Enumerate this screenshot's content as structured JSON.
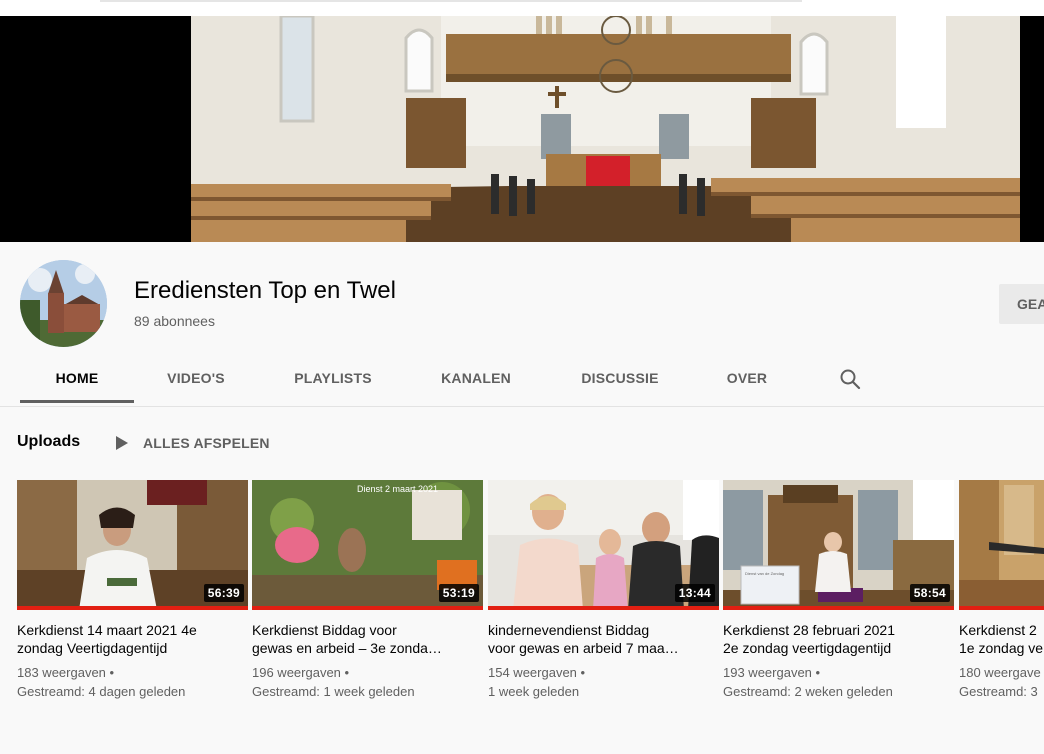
{
  "channel": {
    "name": "Erediensten Top en Twel",
    "subscribers": "89 abonnees",
    "subscribe_label": "GEA"
  },
  "tabs": [
    {
      "label": "HOME",
      "active": true
    },
    {
      "label": "VIDEO'S"
    },
    {
      "label": "PLAYLISTS"
    },
    {
      "label": "KANALEN"
    },
    {
      "label": "DISCUSSIE"
    },
    {
      "label": "OVER"
    }
  ],
  "icons": {
    "search": "search-icon",
    "play": "play-icon"
  },
  "shelf": {
    "title": "Uploads",
    "play_all": "ALLES AFSPELEN"
  },
  "thumb_text": {
    "v2_lines": [
      "Dienst 2 maart 2021"
    ],
    "v4_caption": "Dienst van de Zondag"
  },
  "videos": [
    {
      "title_line1": "Kerkdienst 14 maart 2021 4e",
      "title_line2": "zondag Veertigdagentijd",
      "views": "183 weergaven •",
      "streamed": "Gestreamd: 4 dagen geleden",
      "duration": "56:39"
    },
    {
      "title_line1": "Kerkdienst Biddag voor",
      "title_line2": "gewas en arbeid – 3e zonda…",
      "views": "196 weergaven •",
      "streamed": "Gestreamd: 1 week geleden",
      "duration": "53:19"
    },
    {
      "title_line1": "kindernevendienst Biddag",
      "title_line2": "voor gewas en arbeid 7 maa…",
      "views": "154 weergaven •",
      "streamed": "1 week geleden",
      "duration": "13:44"
    },
    {
      "title_line1": "Kerkdienst 28 februari 2021",
      "title_line2": "2e zondag veertigdagentijd",
      "views": "193 weergaven •",
      "streamed": "Gestreamd: 2 weken geleden",
      "duration": "58:54"
    },
    {
      "title_line1": "Kerkdienst 2",
      "title_line2": "1e zondag ve",
      "views": "180 weergave",
      "streamed": "Gestreamd: 3",
      "duration": ""
    }
  ],
  "colors": {
    "accent": "#e21f12",
    "text": "#030303",
    "secondary": "#606060",
    "background": "#f9f9f9"
  }
}
